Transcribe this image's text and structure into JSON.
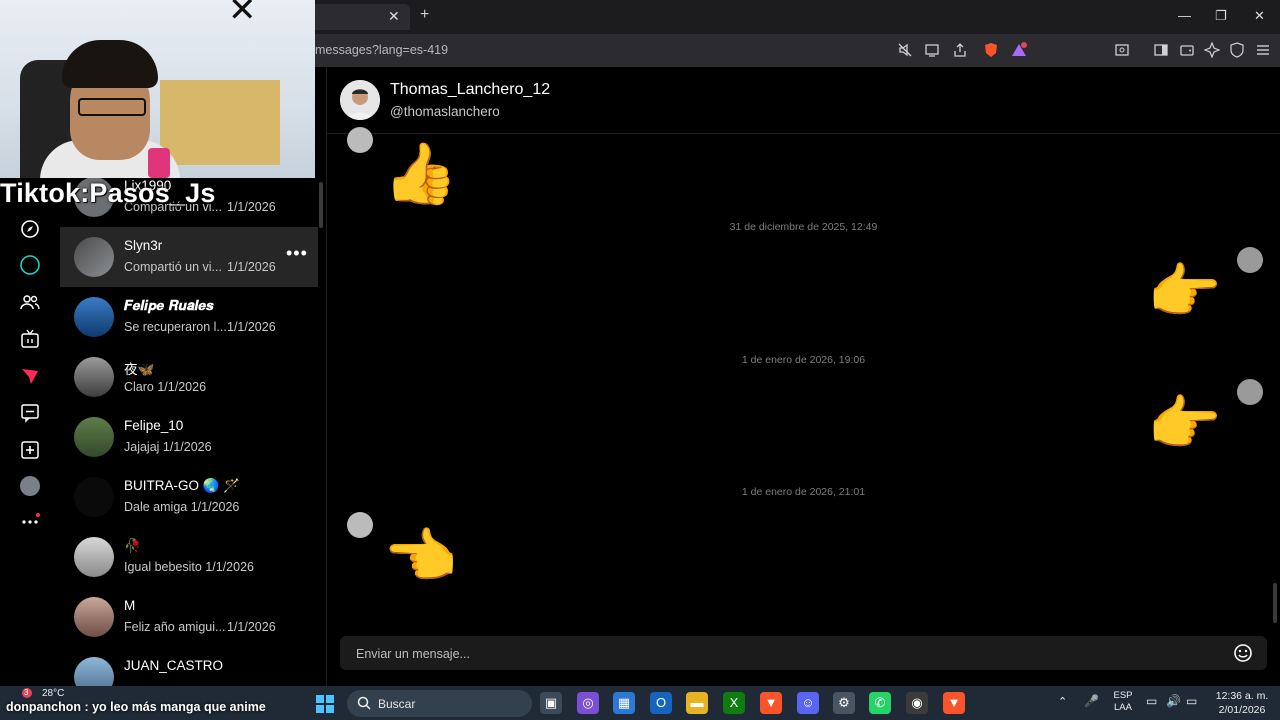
{
  "browser": {
    "url_fragment": "messages?lang=es-419",
    "tab_close": "✕",
    "new_tab": "+",
    "minimize": "—",
    "restore": "❐",
    "close": "✕"
  },
  "stream_tag": "Tiktok:Pasos_Js",
  "conversations": [
    {
      "name": "Lix1990",
      "preview": "Compartió un vi...",
      "date": "1/1/2026"
    },
    {
      "name": "Slyn3r",
      "preview": "Compartió un vi...",
      "date": "1/1/2026",
      "active": true,
      "more": "•••"
    },
    {
      "name": "𝑭𝒆𝒍𝒊𝒑𝒆 𝑹𝒖𝒂𝒍𝒆𝒔",
      "preview": "Se recuperaron l...",
      "date": "1/1/2026"
    },
    {
      "name": "夜🦋",
      "preview": "Claro",
      "date": "1/1/2026"
    },
    {
      "name": "Felipe_10",
      "preview": "Jajajaj",
      "date": "1/1/2026"
    },
    {
      "name": "BUITRA-GO 🌏 🪄",
      "preview": "Dale amiga",
      "date": "1/1/2026"
    },
    {
      "name": "🥀",
      "preview": "Igual bebesito",
      "date": "1/1/2026"
    },
    {
      "name": "M",
      "preview": "Feliz año amigui...",
      "date": "1/1/2026"
    },
    {
      "name": "JUAN_CASTRO",
      "preview": "",
      "date": ""
    }
  ],
  "chat": {
    "name": "Thomas_Lanchero_12",
    "handle": "@thomaslanchero",
    "timestamps": [
      "31 de diciembre de 2025, 12:49",
      "1 de enero de 2026, 19:06",
      "1 de enero de 2026, 21:01"
    ],
    "emojis": {
      "thumbs": "👍",
      "point_right": "👉",
      "point_left": "👈"
    },
    "input_placeholder": "Enviar un mensaje..."
  },
  "taskbar": {
    "weather": "28°C",
    "weather_badge": "3",
    "chat_overlay": "donpanchon : yo leo más manga que anime",
    "search": "Buscar",
    "lang_top": "ESP",
    "lang_bottom": "LAA",
    "time": "12:36 a. m.",
    "date": "2/01/2026"
  },
  "colors": {
    "background": "#000000",
    "active_row": "#262626",
    "accent_teal": "#19d3c5",
    "accent_red": "#fe2c55",
    "taskbar": "#1f2a36"
  }
}
